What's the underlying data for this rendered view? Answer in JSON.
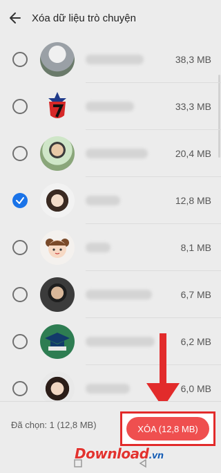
{
  "header": {
    "title": "Xóa dữ liệu trò chuyện",
    "back_icon": "arrow-left-icon"
  },
  "conversations": [
    {
      "size": "38,3 MB",
      "checked": false
    },
    {
      "size": "33,3 MB",
      "checked": false
    },
    {
      "size": "20,4 MB",
      "checked": false
    },
    {
      "size": "12,8 MB",
      "checked": true
    },
    {
      "size": "8,1 MB",
      "checked": false
    },
    {
      "size": "6,7 MB",
      "checked": false
    },
    {
      "size": "6,2 MB",
      "checked": false
    },
    {
      "size": "6,0 MB",
      "checked": false
    }
  ],
  "footer": {
    "selected_label": "Đã chọn: 1 (12,8 MB)",
    "delete_label": "XÓA (12,8 MB)"
  },
  "watermark": {
    "main": "Download",
    "suffix": ".vn"
  },
  "colors": {
    "accent": "#1a73e8",
    "delete": "#ef4f4f",
    "annotation": "#e22b2b"
  }
}
